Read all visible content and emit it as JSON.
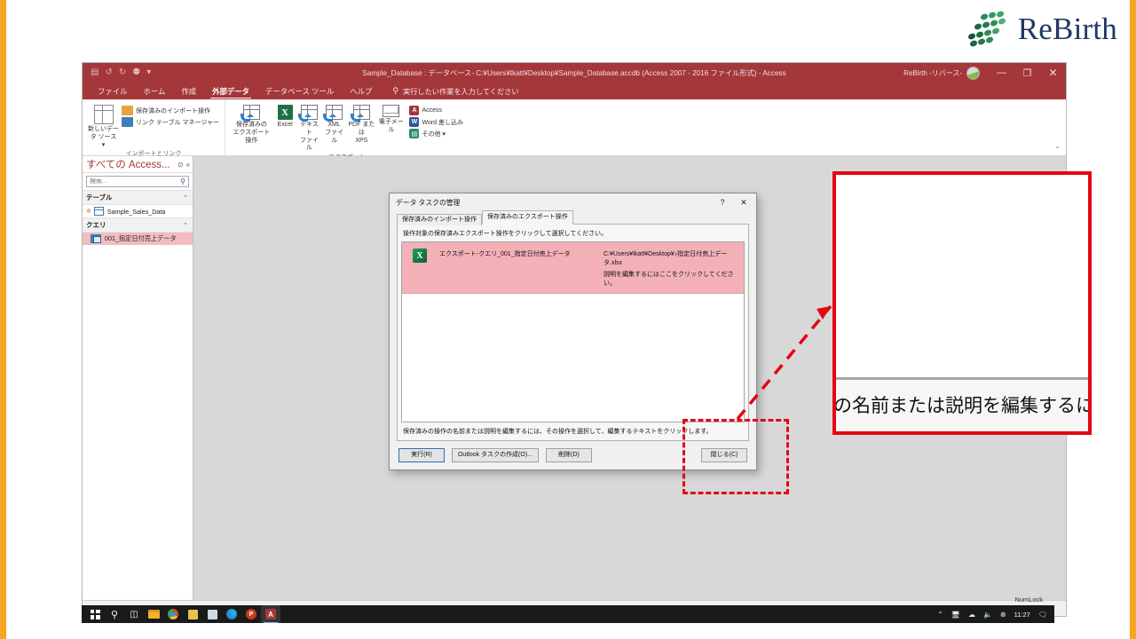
{
  "brand": {
    "logo_text": "ReBirth",
    "logo_dot_color": "#2e8b57",
    "logo_text_color": "#1f3864"
  },
  "accent_colors": {
    "access_red": "#a4373a",
    "annotation_red": "#e30613",
    "slide_border_orange": "#f5a623",
    "selection_pink": "#f3b0b7",
    "excel_green": "#107c41"
  },
  "app_window": {
    "title": "Sample_Database : データベース- C:¥Users¥tkatt¥Desktop¥Sample_Database.accdb (Access 2007 - 2016 ファイル形式)  -  Access",
    "account_name": "ReBirth -リバース-",
    "quick_access": [
      {
        "name": "save-icon",
        "glyph": "▤"
      },
      {
        "name": "undo-icon",
        "glyph": "↺"
      },
      {
        "name": "redo-icon",
        "glyph": "↻"
      },
      {
        "name": "user-icon",
        "glyph": "⚉"
      },
      {
        "name": "customize-qat-icon",
        "glyph": "▾"
      }
    ],
    "window_buttons": [
      {
        "name": "minimize-button",
        "glyph": "—"
      },
      {
        "name": "restore-button",
        "glyph": "❐"
      },
      {
        "name": "close-button",
        "glyph": "✕"
      }
    ]
  },
  "ribbon": {
    "tabs": [
      {
        "label": "ファイル",
        "active": false
      },
      {
        "label": "ホーム",
        "active": false
      },
      {
        "label": "作成",
        "active": false
      },
      {
        "label": "外部データ",
        "active": true
      },
      {
        "label": "データベース ツール",
        "active": false
      },
      {
        "label": "ヘルプ",
        "active": false
      }
    ],
    "tell_me": "実行したい作業を入力してください",
    "groups": [
      {
        "label": "インポートとリンク",
        "big_buttons": [
          {
            "label": "新しいデー\nタ ソース ▾",
            "icon": "new-data-source-icon"
          }
        ],
        "small_buttons": [
          {
            "label": "保存済みのインポート操作",
            "icon": "saved-imports-icon"
          },
          {
            "label": "リンク テーブル マネージャー",
            "icon": "linked-table-manager-icon"
          }
        ]
      },
      {
        "label": "エクスポート",
        "medium_buttons": [
          {
            "label": "保存済みの\nエクスポート操作",
            "icon": "saved-exports-icon"
          },
          {
            "label": "Excel",
            "icon": "excel-export-icon"
          },
          {
            "label": "テキスト\nファイル",
            "icon": "text-file-export-icon"
          },
          {
            "label": "XML\nファイル",
            "icon": "xml-file-export-icon"
          },
          {
            "label": "PDF または\nXPS",
            "icon": "pdf-xps-export-icon"
          },
          {
            "label": "電子メール",
            "icon": "email-icon"
          }
        ],
        "small_buttons": [
          {
            "label": "Access",
            "icon": "access-icon",
            "color": "#a4373a"
          },
          {
            "label": "Word 差し込み",
            "icon": "word-merge-icon",
            "color": "#2b579a"
          },
          {
            "label": "その他 ▾",
            "icon": "more-icon",
            "color": "#2b8f6b"
          }
        ]
      }
    ],
    "collapse_glyph": "⌃"
  },
  "nav_pane": {
    "title": "すべての Access...",
    "header_icons": [
      {
        "name": "nav-options-icon",
        "glyph": "⊙"
      },
      {
        "name": "shutter-bar-collapse-icon",
        "glyph": "«"
      }
    ],
    "search_placeholder": "検索...",
    "search_value": "",
    "search_icon": "search-icon",
    "groups": [
      {
        "label": "テーブル",
        "chevron": "⌃",
        "items": [
          {
            "label": "Sample_Sales_Data",
            "icon": "table-icon",
            "selected": false,
            "new_marker": "✽"
          }
        ]
      },
      {
        "label": "クエリ",
        "chevron": "⌃",
        "items": [
          {
            "label": "001_指定日付売上データ",
            "icon": "query-icon",
            "selected": true
          }
        ]
      }
    ]
  },
  "status_bar": {
    "text": ""
  },
  "dialog": {
    "title": "データ タスクの管理",
    "help_button": "?",
    "close_button": "✕",
    "tabs": [
      {
        "label": "保存済みのインポート操作",
        "active": false
      },
      {
        "label": "保存済みのエクスポート操作",
        "active": true
      }
    ],
    "instruction": "操作対象の保存済みエクスポート操作をクリックして選択してください。",
    "rows": [
      {
        "icon": "excel-file-icon",
        "icon_glyph": "X",
        "name": "エクスポート-クエリ_001_指定日付売上データ",
        "path": "C:¥Users¥tkatt¥Desktop¥♪指定日付売上データ.xlsx",
        "description_hint": "説明を編集するにはここをクリックしてください。",
        "selected": true
      }
    ],
    "hint": "保存済みの操作の名前または説明を編集するには、その操作を選択して、編集するテキストをクリックします。",
    "buttons": [
      {
        "label": "実行(R)",
        "accel": "R",
        "name": "run-button",
        "default": true
      },
      {
        "label": "Outlook タスクの作成(O)...",
        "accel": "O",
        "name": "create-outlook-task-button",
        "default": false
      },
      {
        "label": "削除(D)",
        "accel": "D",
        "name": "delete-button",
        "default": false
      },
      {
        "label": "閉じる(C)",
        "accel": "C",
        "name": "close-button",
        "default": false
      }
    ]
  },
  "annotation": {
    "highlighted_button_label": "閉じる(C)",
    "dashed_box_target": "close-button",
    "callout_border_color": "#e30613"
  },
  "taskbar": {
    "start_icon": "windows-start-icon",
    "items": [
      {
        "name": "search-icon",
        "glyph": "⌕",
        "active": false
      },
      {
        "name": "task-view-icon",
        "glyph": "❏",
        "active": false
      },
      {
        "name": "file-explorer-icon",
        "glyph": "",
        "active": false,
        "color": "#f0b429"
      },
      {
        "name": "chrome-icon",
        "glyph": "",
        "active": false,
        "color": "#d94a36"
      },
      {
        "name": "notepad-icon",
        "glyph": "",
        "active": false,
        "color": "#e8c34a"
      },
      {
        "name": "store-icon",
        "glyph": "",
        "active": false,
        "color": "#cfd8e0"
      },
      {
        "name": "edge-icon",
        "glyph": "",
        "active": false,
        "color": "#1b88c9"
      },
      {
        "name": "powerpoint-icon",
        "glyph": "P",
        "active": false,
        "color": "#c43e1c"
      },
      {
        "name": "access-icon",
        "glyph": "A",
        "active": true,
        "color": "#a4373a"
      }
    ],
    "tray": {
      "overflow_glyph": "⌃",
      "icons": [
        {
          "name": "network-icon",
          "glyph": "🖳"
        },
        {
          "name": "onedrive-icon",
          "glyph": "☁"
        },
        {
          "name": "volume-icon",
          "glyph": "🔊"
        },
        {
          "name": "action-center-badge-icon",
          "glyph": "⊗"
        }
      ],
      "time": "11:27",
      "notification_icon": "notification-icon",
      "numlock_label": "NumLock"
    }
  }
}
